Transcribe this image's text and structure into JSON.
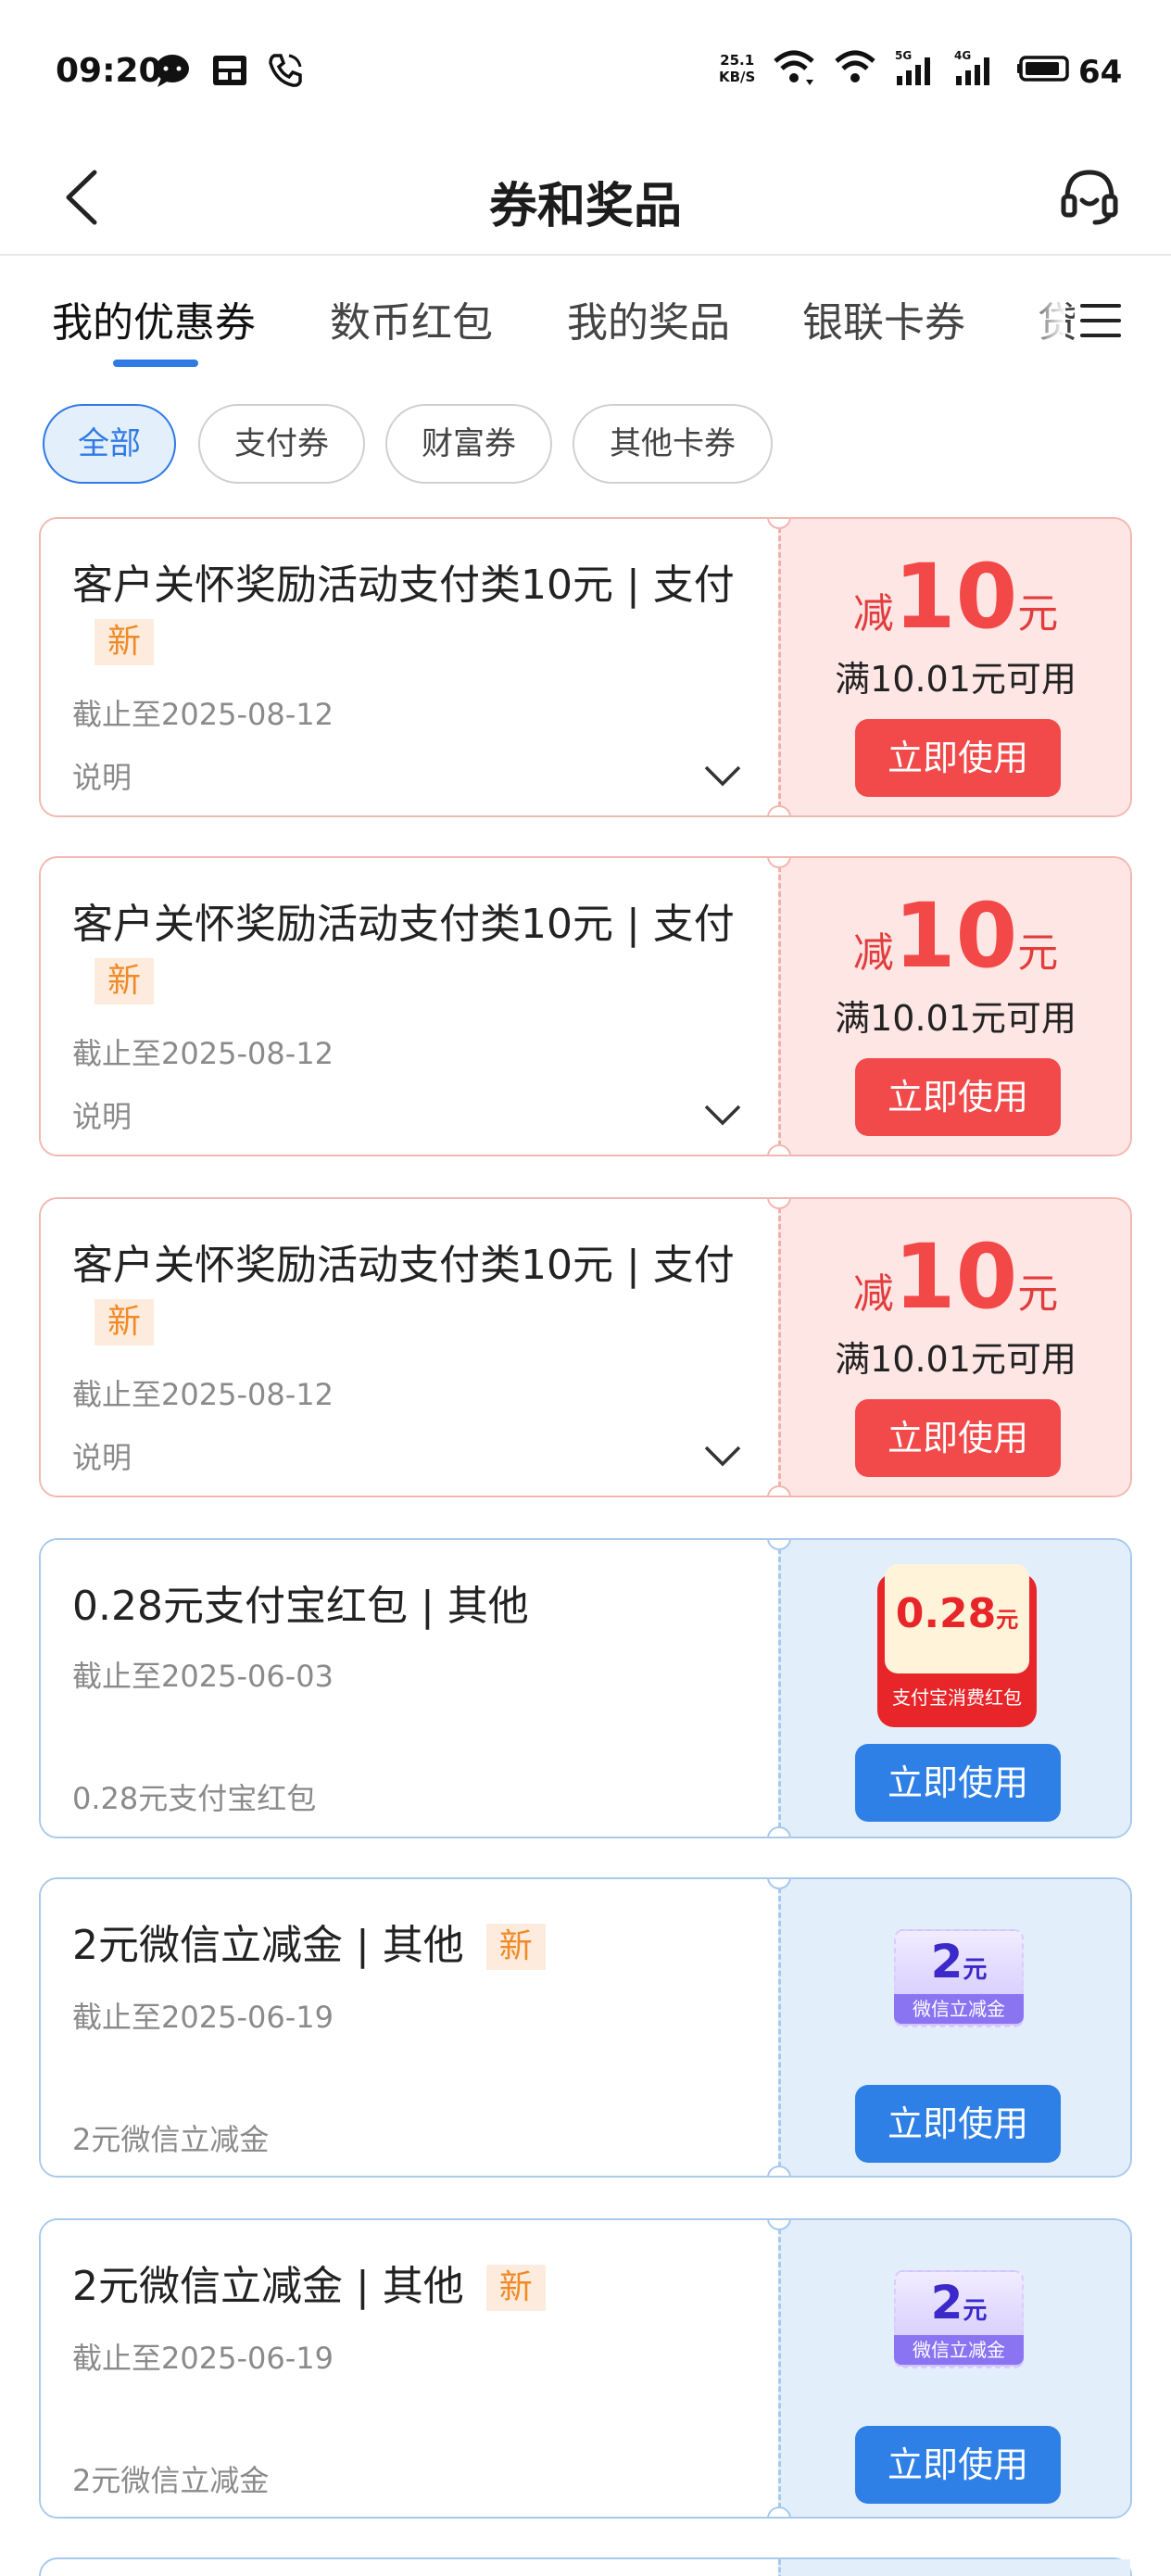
{
  "status_bar": {
    "time": "09:20",
    "net_speed_value": "25.1",
    "net_speed_unit": "KB/S",
    "battery": "64",
    "icons": [
      "chat-bubble-icon",
      "sim-card-icon",
      "phone-call-icon",
      "wifi-icon",
      "wifi-icon",
      "signal-5g-icon",
      "signal-4g-icon",
      "battery-icon"
    ]
  },
  "header": {
    "title": "券和奖品",
    "back_icon": "chevron-left-icon",
    "support_icon": "headset-icon"
  },
  "tabs": [
    {
      "label": "我的优惠券",
      "active": true
    },
    {
      "label": "数币红包",
      "active": false
    },
    {
      "label": "我的奖品",
      "active": false
    },
    {
      "label": "银联卡券",
      "active": false
    },
    {
      "label": "贷",
      "active": false
    }
  ],
  "filters": [
    {
      "label": "全部",
      "active": true
    },
    {
      "label": "支付券",
      "active": false
    },
    {
      "label": "财富券",
      "active": false
    },
    {
      "label": "其他卡券",
      "active": false
    }
  ],
  "coupons": [
    {
      "title": "客户关怀奖励活动支付类10元 | 支付",
      "new_tag": "新",
      "expiry": "截止至2025-08-12",
      "desc": "说明",
      "prefix": "减",
      "amount": "10",
      "unit": "元",
      "condition": "满10.01元可用",
      "button": "立即使用"
    },
    {
      "title": "客户关怀奖励活动支付类10元 | 支付",
      "new_tag": "新",
      "expiry": "截止至2025-08-12",
      "desc": "说明",
      "prefix": "减",
      "amount": "10",
      "unit": "元",
      "condition": "满10.01元可用",
      "button": "立即使用"
    },
    {
      "title": "客户关怀奖励活动支付类10元 | 支付",
      "new_tag": "新",
      "expiry": "截止至2025-08-12",
      "desc": "说明",
      "prefix": "减",
      "amount": "10",
      "unit": "元",
      "condition": "满10.01元可用",
      "button": "立即使用"
    },
    {
      "title": "0.28元支付宝红包 | 其他",
      "expiry": "截止至2025-06-03",
      "desc": "0.28元支付宝红包",
      "badge_value": "0.28",
      "badge_unit": "元",
      "badge_label": "支付宝消费红包",
      "button": "立即使用"
    },
    {
      "title": "2元微信立减金 | 其他",
      "new_tag": "新",
      "expiry": "截止至2025-06-19",
      "desc": "2元微信立减金",
      "badge_value": "2",
      "badge_unit": "元",
      "badge_label": "微信立减金",
      "button": "立即使用"
    },
    {
      "title": "2元微信立减金 | 其他",
      "new_tag": "新",
      "expiry": "截止至2025-06-19",
      "desc": "2元微信立减金",
      "badge_value": "2",
      "badge_unit": "元",
      "badge_label": "微信立减金",
      "button": "立即使用"
    }
  ],
  "colors": {
    "accent_blue": "#2f7ae5",
    "coupon_red": "#f24a4a",
    "new_tag": "#f08a26"
  }
}
